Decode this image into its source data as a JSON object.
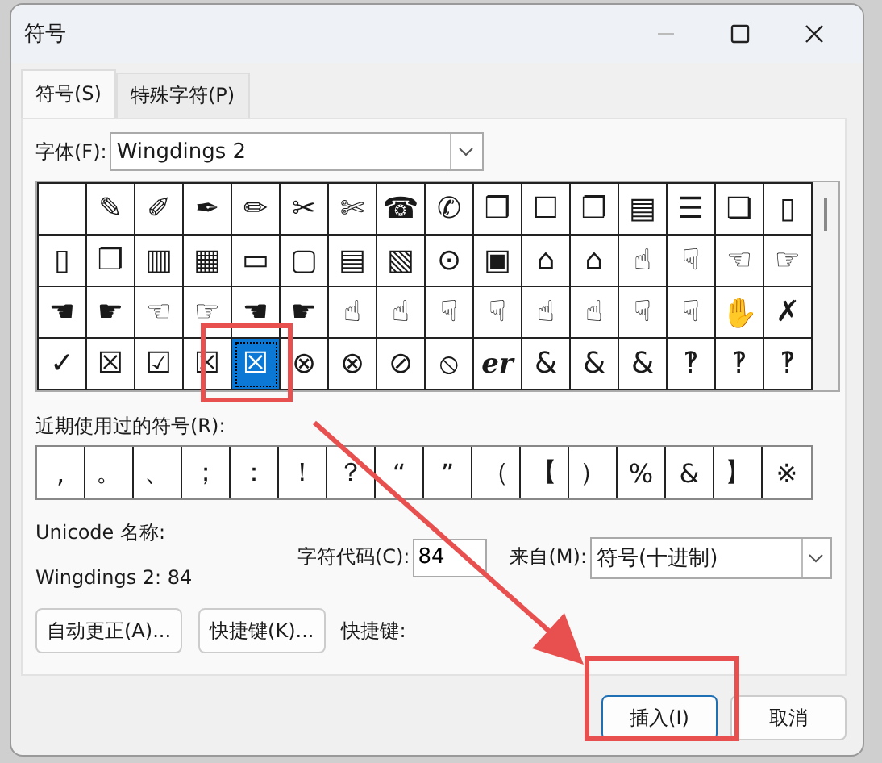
{
  "window": {
    "title": "符号"
  },
  "tabs": [
    {
      "label": "符号(S)",
      "selected": true
    },
    {
      "label": "特殊字符(P)",
      "selected": false
    }
  ],
  "font": {
    "label": "字体(F):",
    "value": "Wingdings 2"
  },
  "symbols": [
    [
      {
        "selected": false
      },
      {
        "glyph": "✎",
        "selected": false
      },
      {
        "glyph": "✐",
        "selected": false
      },
      {
        "glyph": "✒",
        "selected": false
      },
      {
        "glyph": "✏",
        "selected": false
      },
      {
        "glyph": "✂",
        "selected": false
      },
      {
        "glyph": "✄",
        "selected": false
      },
      {
        "glyph": "☎",
        "selected": false
      },
      {
        "glyph": "✆",
        "selected": false
      },
      {
        "glyph": "❒",
        "selected": false
      },
      {
        "glyph": "☐",
        "selected": false
      },
      {
        "glyph": "❐",
        "selected": false
      },
      {
        "glyph": "▤",
        "selected": false
      },
      {
        "glyph": "☰",
        "selected": false
      },
      {
        "glyph": "❏",
        "selected": false
      },
      {
        "glyph": "▯",
        "selected": false
      }
    ],
    [
      {
        "glyph": "▯",
        "selected": false
      },
      {
        "glyph": "❐",
        "selected": false
      },
      {
        "glyph": "▥",
        "selected": false
      },
      {
        "glyph": "▦",
        "selected": false
      },
      {
        "glyph": "▭",
        "selected": false
      },
      {
        "glyph": "▢",
        "selected": false
      },
      {
        "glyph": "▤",
        "selected": false
      },
      {
        "glyph": "▧",
        "selected": false
      },
      {
        "glyph": "⊙",
        "selected": false
      },
      {
        "glyph": "▣",
        "selected": false
      },
      {
        "glyph": "⌂",
        "selected": false
      },
      {
        "glyph": "⌂",
        "selected": false
      },
      {
        "glyph": "☝",
        "selected": false
      },
      {
        "glyph": "☟",
        "selected": false
      },
      {
        "glyph": "☜",
        "selected": false
      },
      {
        "glyph": "☞",
        "selected": false
      }
    ],
    [
      {
        "glyph": "☚",
        "selected": false
      },
      {
        "glyph": "☛",
        "selected": false
      },
      {
        "glyph": "☜",
        "selected": false
      },
      {
        "glyph": "☞",
        "selected": false
      },
      {
        "glyph": "☚",
        "selected": false
      },
      {
        "glyph": "☛",
        "selected": false
      },
      {
        "glyph": "☝",
        "selected": false
      },
      {
        "glyph": "☝",
        "selected": false
      },
      {
        "glyph": "☟",
        "selected": false
      },
      {
        "glyph": "☟",
        "selected": false
      },
      {
        "glyph": "☝",
        "selected": false
      },
      {
        "glyph": "☝",
        "selected": false
      },
      {
        "glyph": "☟",
        "selected": false
      },
      {
        "glyph": "☟",
        "selected": false
      },
      {
        "glyph": "✋",
        "selected": false
      },
      {
        "glyph": "✗",
        "selected": false
      }
    ],
    [
      {
        "glyph": "✓",
        "selected": false
      },
      {
        "glyph": "☒",
        "selected": false
      },
      {
        "glyph": "☑",
        "selected": false
      },
      {
        "glyph": "☒",
        "selected": false
      },
      {
        "glyph": "☒",
        "selected": true
      },
      {
        "glyph": "⊗",
        "selected": false
      },
      {
        "glyph": "⊗",
        "selected": false
      },
      {
        "glyph": "⊘",
        "selected": false
      },
      {
        "glyph": "⦸",
        "selected": false
      },
      {
        "glyph": "er",
        "selected": false
      },
      {
        "glyph": "&",
        "selected": false
      },
      {
        "glyph": "&",
        "selected": false
      },
      {
        "glyph": "&",
        "selected": false
      },
      {
        "glyph": "‽",
        "selected": false
      },
      {
        "glyph": "‽",
        "selected": false
      },
      {
        "glyph": "‽",
        "selected": false
      }
    ]
  ],
  "recent": {
    "label": "近期使用过的符号(R):",
    "symbols": [
      ",",
      "。",
      "、",
      "；",
      "：",
      "！",
      "？",
      "“",
      "”",
      "（",
      "【",
      "）",
      "%",
      "&",
      "】",
      "※"
    ]
  },
  "unicode_name": {
    "label": "Unicode 名称:",
    "value": "Wingdings 2: 84"
  },
  "char_code": {
    "label": "字符代码(C):",
    "value": "84"
  },
  "from": {
    "label": "来自(M):",
    "value": "符号(十进制)"
  },
  "buttons": [
    "自动更正(A)...",
    "快捷键(K)..."
  ],
  "shortcut_label": "快捷键:",
  "footer_buttons": [
    {
      "label": "插入(I)",
      "default": true
    },
    {
      "label": "取消",
      "default": false
    }
  ]
}
